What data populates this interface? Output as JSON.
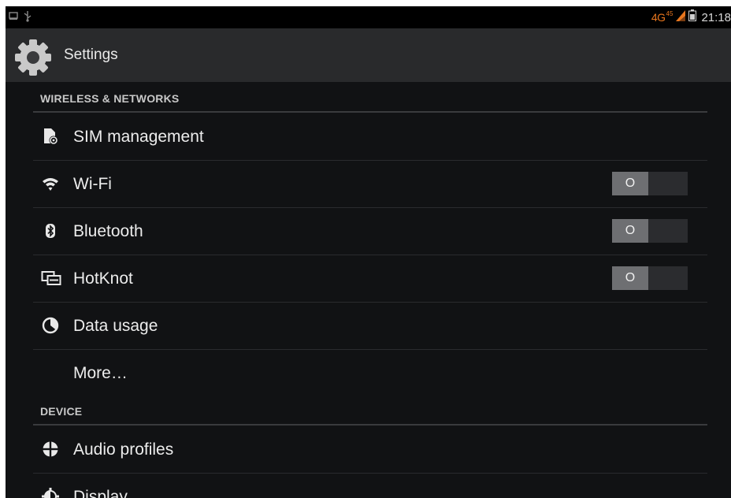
{
  "status_bar": {
    "left_icons": [
      "screenshot-icon",
      "usb-icon"
    ],
    "network_type": "4G",
    "network_sup": "45",
    "time": "21:18",
    "network_color": "#e8761e"
  },
  "action_bar": {
    "title": "Settings",
    "icon": "gear-icon"
  },
  "sections": {
    "wireless": {
      "header": "WIRELESS & NETWORKS",
      "items": [
        {
          "label": "SIM management",
          "icon": "sim-card-icon"
        },
        {
          "label": "Wi-Fi",
          "icon": "wifi-icon",
          "toggle_state": "O"
        },
        {
          "label": "Bluetooth",
          "icon": "bluetooth-icon",
          "toggle_state": "O"
        },
        {
          "label": "HotKnot",
          "icon": "hotknot-icon",
          "toggle_state": "O"
        },
        {
          "label": "Data usage",
          "icon": "data-usage-icon"
        },
        {
          "label": "More…"
        }
      ]
    },
    "device": {
      "header": "DEVICE",
      "items": [
        {
          "label": "Audio profiles",
          "icon": "audio-profiles-icon"
        },
        {
          "label": "Display",
          "icon": "display-icon"
        }
      ]
    }
  }
}
